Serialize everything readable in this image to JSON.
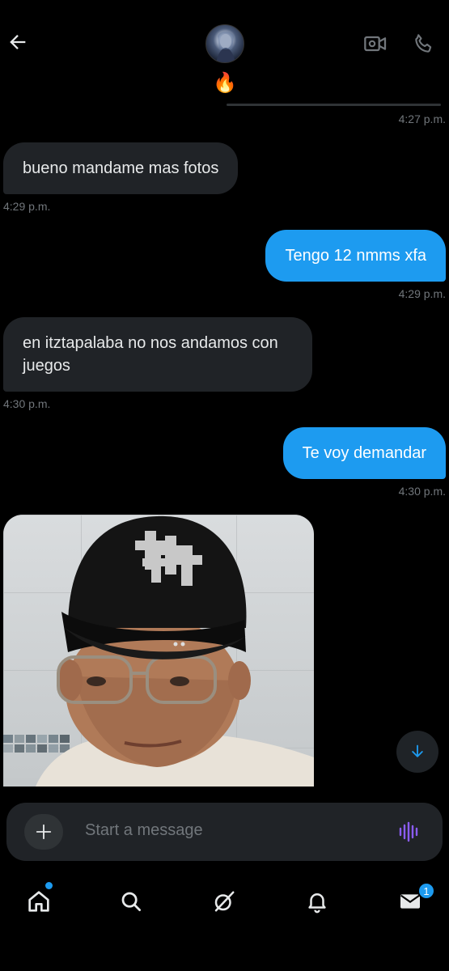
{
  "header": {
    "status_emoji": "🔥"
  },
  "messages": [
    {
      "id": "ts0",
      "time": "4:27 p.m."
    },
    {
      "id": "m1",
      "direction": "in",
      "text": "bueno mandame mas fotos",
      "time": "4:29 p.m."
    },
    {
      "id": "m2",
      "direction": "out",
      "text": "Tengo 12 nmms xfa",
      "time": "4:29 p.m."
    },
    {
      "id": "m3",
      "direction": "in",
      "text": "en itztapalaba no nos andamos con juegos",
      "time": "4:30 p.m."
    },
    {
      "id": "m4",
      "direction": "out",
      "text": "Te voy demandar",
      "time": "4:30 p.m."
    },
    {
      "id": "m5",
      "direction": "in",
      "type": "photo"
    }
  ],
  "composer": {
    "placeholder": "Start a message"
  },
  "nav": {
    "items": [
      "home-icon",
      "search-icon",
      "grok-icon",
      "notifications-icon",
      "messages-icon"
    ],
    "messages_badge": "1"
  },
  "colors": {
    "accent": "#1d9bf0",
    "incoming_bubble": "#202327",
    "background": "#000000",
    "muted_text": "#71767b",
    "voice_icon": "#8b5cf6"
  }
}
